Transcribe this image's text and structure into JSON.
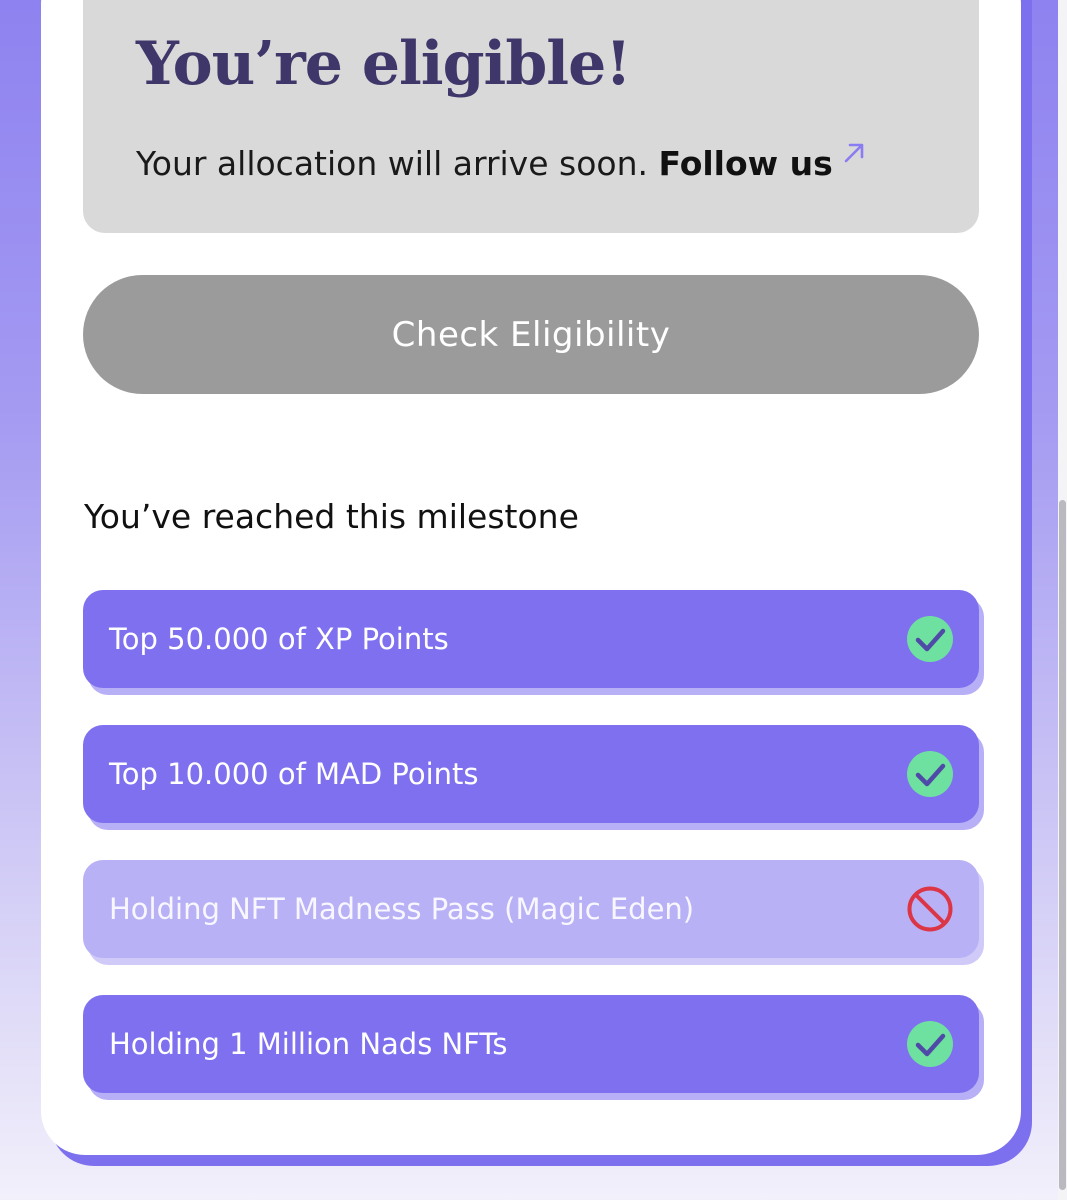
{
  "eligibility": {
    "title": "You’re eligible!",
    "message": "Your allocation will arrive soon.",
    "follow_label": "Follow us",
    "follow_icon": "external-arrow-icon",
    "accent_color": "#8a7cf2"
  },
  "check_button": {
    "label": "Check Eligibility"
  },
  "milestones": {
    "heading": "You’ve reached this milestone",
    "items": [
      {
        "label": "Top 50.000 of XP Points",
        "achieved": true,
        "icon": "check-circle-icon"
      },
      {
        "label": "Top 10.000 of MAD Points",
        "achieved": true,
        "icon": "check-circle-icon"
      },
      {
        "label": "Holding NFT Madness Pass (Magic Eden)",
        "achieved": false,
        "icon": "prohibited-icon"
      },
      {
        "label": "Holding 1 Million Nads NFTs",
        "achieved": true,
        "icon": "check-circle-icon"
      }
    ]
  },
  "colors": {
    "milestone_done": "#7e70ef",
    "milestone_missing": "#b8b1f6",
    "check_green": "#6ee0a0",
    "prohibited_red": "#dc3545",
    "button_disabled": "#9b9b9b",
    "title_color": "#3f3669"
  }
}
